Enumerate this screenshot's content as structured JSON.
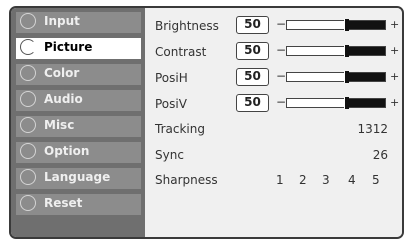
{
  "menu": {
    "items": [
      {
        "label": "Input",
        "selected": false
      },
      {
        "label": "Picture",
        "selected": true
      },
      {
        "label": "Color",
        "selected": false
      },
      {
        "label": "Audio",
        "selected": false
      },
      {
        "label": "Misc",
        "selected": false
      },
      {
        "label": "Option",
        "selected": false
      },
      {
        "label": "Language",
        "selected": false
      },
      {
        "label": "Reset",
        "selected": false
      }
    ]
  },
  "settings": {
    "brightness": {
      "label": "Brightness",
      "value": "50"
    },
    "contrast": {
      "label": "Contrast",
      "value": "50"
    },
    "posih": {
      "label": "PosiH",
      "value": "50"
    },
    "posiv": {
      "label": "PosiV",
      "value": "50"
    },
    "tracking": {
      "label": "Tracking",
      "value": "1312"
    },
    "sync": {
      "label": "Sync",
      "value": "26"
    },
    "sharpness": {
      "label": "Sharpness",
      "options": [
        "1",
        "2",
        "3",
        "4",
        "5"
      ]
    }
  },
  "symbols": {
    "minus": "−",
    "plus": "+"
  },
  "icons": {
    "menu_bullet": "circle-ring-icon"
  },
  "colors": {
    "sidebar": "#6f6f6f",
    "menu_item": "#8c8c8c",
    "selected_item": "#ffffff",
    "panel": "#f0f0f0"
  }
}
